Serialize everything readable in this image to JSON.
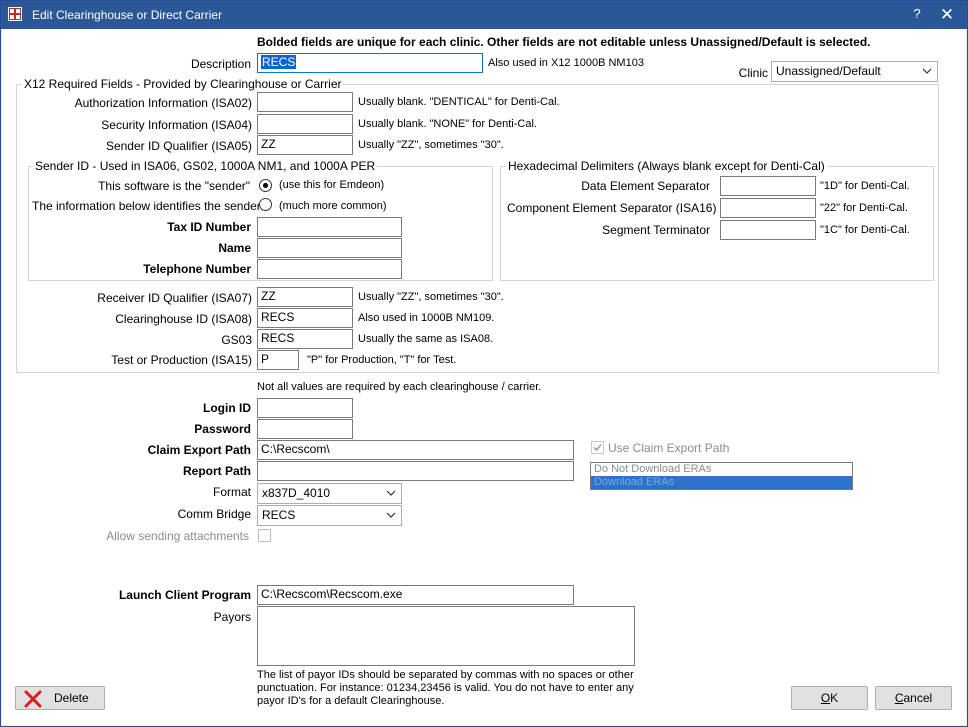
{
  "window": {
    "title": "Edit Clearinghouse or Direct Carrier",
    "help_label": "?",
    "close_label": "✕"
  },
  "header": {
    "notice": "Bolded fields are unique for each clinic.  Other fields are not editable unless Unassigned/Default is selected."
  },
  "description": {
    "label": "Description",
    "value": "RECS",
    "note": "Also used in X12 1000B NM103"
  },
  "clinic": {
    "label": "Clinic",
    "value": "Unassigned/Default"
  },
  "x12": {
    "title": "X12 Required Fields - Provided by Clearinghouse or Carrier",
    "isa02": {
      "label": "Authorization Information (ISA02)",
      "value": "",
      "note": "Usually blank.  \"DENTICAL\" for Denti-Cal."
    },
    "isa04": {
      "label": "Security Information (ISA04)",
      "value": "",
      "note": "Usually blank.  \"NONE\" for Denti-Cal."
    },
    "isa05": {
      "label": "Sender ID Qualifier (ISA05)",
      "value": "ZZ",
      "note": "Usually \"ZZ\", sometimes \"30\"."
    },
    "isa07": {
      "label": "Receiver ID Qualifier (ISA07)",
      "value": "ZZ",
      "note": "Usually \"ZZ\", sometimes \"30\"."
    },
    "isa08": {
      "label": "Clearinghouse ID (ISA08)",
      "value": "RECS",
      "note": "Also used in 1000B NM109."
    },
    "gs03": {
      "label": "GS03",
      "value": "RECS",
      "note": "Usually the same as ISA08."
    },
    "isa15": {
      "label": "Test or Production (ISA15)",
      "value": "P",
      "note": "\"P\" for Production,  \"T\" for Test."
    }
  },
  "sender": {
    "title": "Sender ID - Used in ISA06, GS02, 1000A NM1, and 1000A PER",
    "option_software": {
      "label": "This software is the \"sender\"",
      "note": "(use this for Emdeon)",
      "selected": true
    },
    "option_below": {
      "label": "The information below identifies the sender",
      "note": "(much more common)",
      "selected": false
    },
    "tax_id": {
      "label": "Tax ID Number",
      "value": ""
    },
    "name": {
      "label": "Name",
      "value": ""
    },
    "phone": {
      "label": "Telephone Number",
      "value": ""
    }
  },
  "hex": {
    "title": "Hexadecimal Delimiters (Always blank except for Denti-Cal)",
    "data_sep": {
      "label": "Data Element Separator",
      "value": "",
      "note": "\"1D\" for Denti-Cal."
    },
    "comp_sep": {
      "label": "Component Element Separator (ISA16)",
      "value": "",
      "note": "\"22\" for Denti-Cal."
    },
    "seg_term": {
      "label": "Segment Terminator",
      "value": "",
      "note": "\"1C\" for Denti-Cal."
    }
  },
  "misc": {
    "required_note": "Not all values are required by each clearinghouse / carrier.",
    "login": {
      "label": "Login ID",
      "value": ""
    },
    "password": {
      "label": "Password",
      "value": ""
    },
    "claim_export": {
      "label": "Claim Export Path",
      "value": "C:\\Recscom\\"
    },
    "report_path": {
      "label": "Report Path",
      "value": ""
    },
    "format": {
      "label": "Format",
      "value": "x837D_4010"
    },
    "comm_bridge": {
      "label": "Comm Bridge",
      "value": "RECS"
    },
    "allow_attachments": {
      "label": "Allow sending attachments",
      "checked": false
    },
    "use_claim_export": {
      "label": "Use Claim Export Path",
      "checked": true
    },
    "era_options": [
      "Do Not Download ERAs",
      "Download ERAs"
    ],
    "era_selected_index": 1,
    "launch_client": {
      "label": "Launch Client Program",
      "value": "C:\\Recscom\\Recscom.exe"
    },
    "payors": {
      "label": "Payors",
      "value": ""
    },
    "payor_note": "The list of payor IDs should be separated by commas with no spaces or other punctuation.  For instance: 01234,23456 is valid.  You do not have to enter any payor ID's for a default Clearinghouse."
  },
  "buttons": {
    "delete": "Delete",
    "ok_u": "O",
    "ok_rest": "K",
    "cancel_u": "C",
    "cancel_rest": "ancel"
  },
  "colors": {
    "titlebar": "#2b5797",
    "selection": "#0a64d2",
    "delete_icon": "#d81e1e"
  }
}
